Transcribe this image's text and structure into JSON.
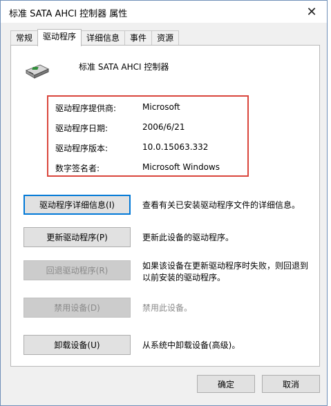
{
  "window": {
    "title": "标准 SATA AHCI 控制器 属性",
    "close_glyph": "✕"
  },
  "tabs": [
    {
      "label": "常规",
      "active": false
    },
    {
      "label": "驱动程序",
      "active": true
    },
    {
      "label": "详细信息",
      "active": false
    },
    {
      "label": "事件",
      "active": false
    },
    {
      "label": "资源",
      "active": false
    }
  ],
  "device": {
    "name": "标准 SATA AHCI 控制器",
    "icon": "storage-controller-icon"
  },
  "driver_info": {
    "provider_label": "驱动程序提供商:",
    "provider_value": "Microsoft",
    "date_label": "驱动程序日期:",
    "date_value": "2006/6/21",
    "version_label": "驱动程序版本:",
    "version_value": "10.0.15063.332",
    "signer_label": "数字签名者:",
    "signer_value": "Microsoft Windows",
    "highlight_color": "#d9443b"
  },
  "actions": [
    {
      "label": "驱动程序详细信息(I)",
      "desc": "查看有关已安装驱动程序文件的详细信息。",
      "enabled": true
    },
    {
      "label": "更新驱动程序(P)",
      "desc": "更新此设备的驱动程序。",
      "enabled": true
    },
    {
      "label": "回退驱动程序(R)",
      "desc": "如果该设备在更新驱动程序时失败，则回退到以前安装的驱动程序。",
      "enabled": false
    },
    {
      "label": "禁用设备(D)",
      "desc": "禁用此设备。",
      "enabled": false
    },
    {
      "label": "卸载设备(U)",
      "desc": "从系统中卸载设备(高级)。",
      "enabled": true
    }
  ],
  "footer": {
    "ok_label": "确定",
    "cancel_label": "取消"
  }
}
